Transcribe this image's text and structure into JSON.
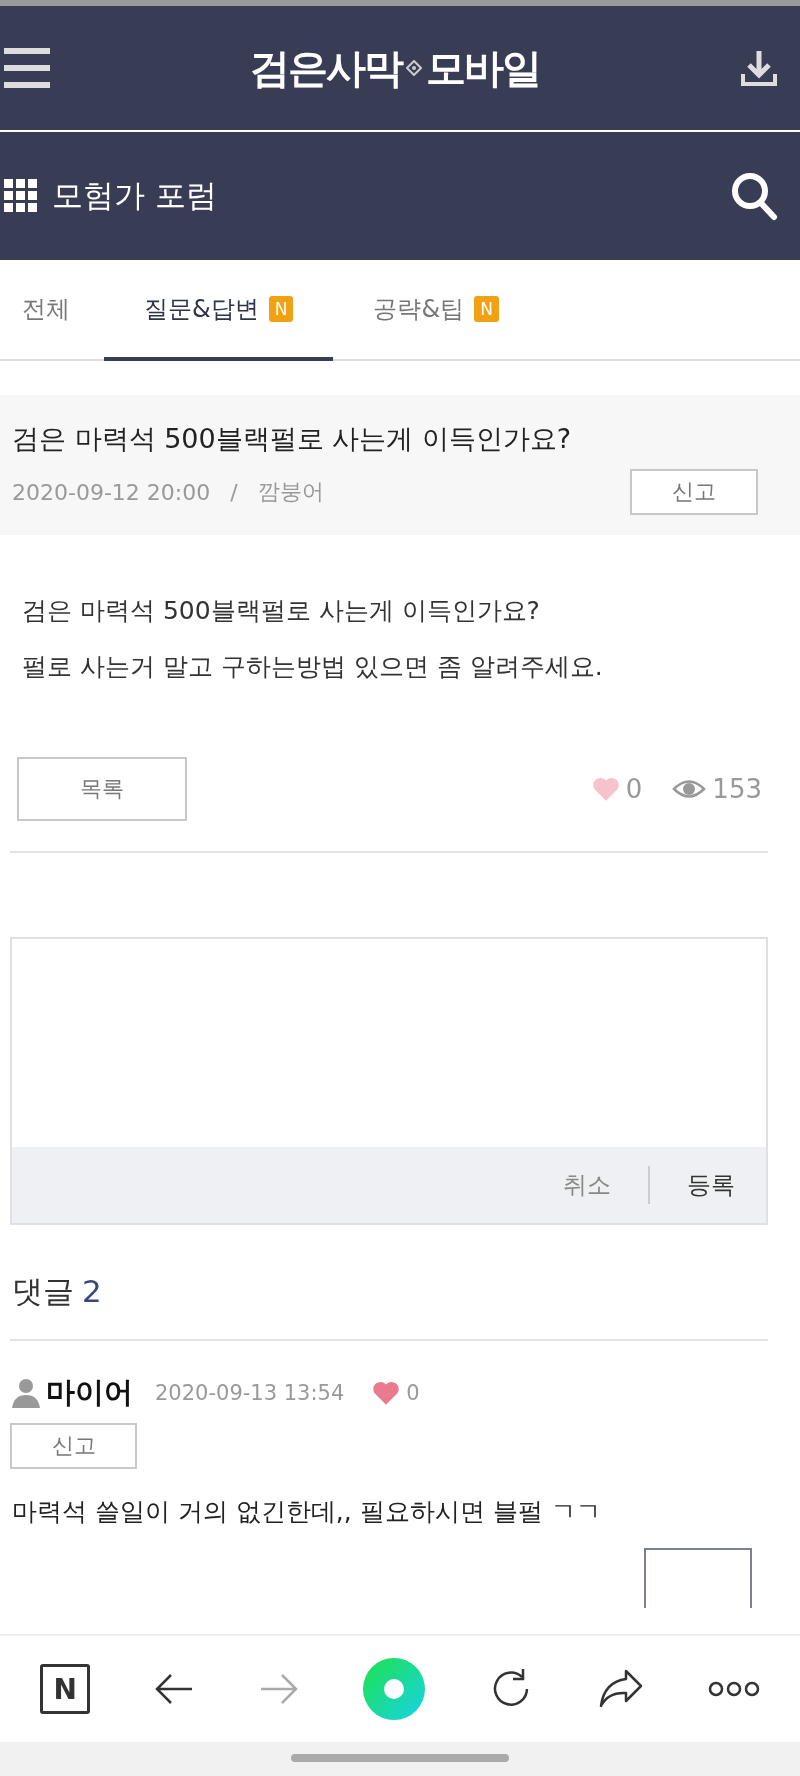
{
  "header": {
    "logo_left": "검은사막",
    "logo_right": "모바일"
  },
  "board": {
    "title": "모험가 포럼"
  },
  "tabs": [
    {
      "label": "전체",
      "selected": false
    },
    {
      "label": "질문&답변",
      "selected": true,
      "badge": "N"
    },
    {
      "label": "공략&팁",
      "selected": false,
      "badge": "N"
    }
  ],
  "post": {
    "title": "검은 마력석 500블랙펄로 사는게 이득인가요?",
    "date": "2020-09-12 20:00",
    "separator": "/",
    "author": "깜붕어",
    "report_button": "신고",
    "body": [
      "검은 마력석 500블랙펄로 사는게 이득인가요?",
      "펄로 사는거 말고 구하는방법 있으면 좀 알려주세요."
    ],
    "list_button": "목록",
    "likes": "0",
    "views": "153"
  },
  "comment_form": {
    "cancel": "취소",
    "submit": "등록"
  },
  "comments_header": {
    "label": "댓글",
    "count": "2"
  },
  "comments": [
    {
      "author": "마이어",
      "date": "2020-09-13 13:54",
      "likes": "0",
      "report_button": "신고",
      "text": "마력석 쓸일이 거의 없긴한데,, 필요하시면 블펄 ㄱㄱ"
    }
  ],
  "bottom_nav": {
    "logo": "N"
  }
}
